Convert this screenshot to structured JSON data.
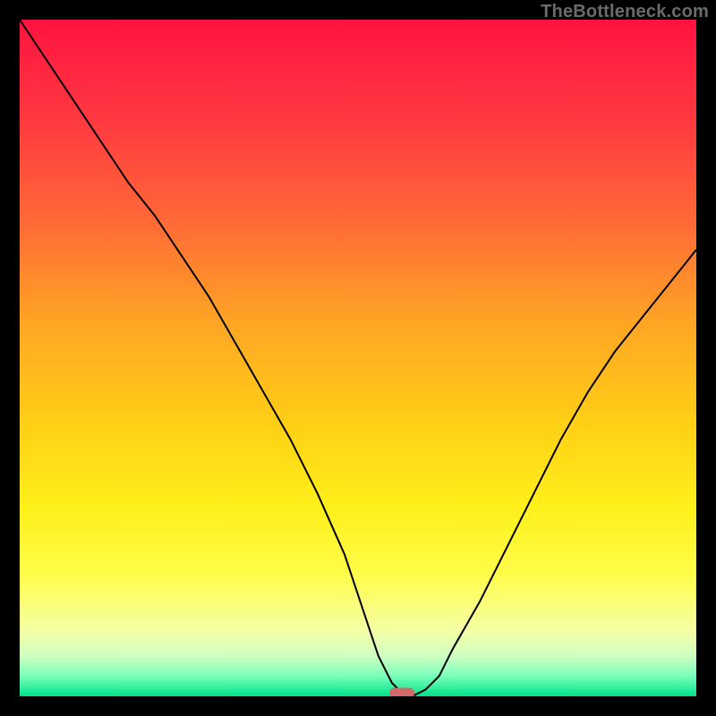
{
  "watermark": "TheBottleneck.com",
  "chart_data": {
    "type": "line",
    "title": "",
    "xlabel": "",
    "ylabel": "",
    "xlim": [
      0,
      100
    ],
    "ylim": [
      0,
      100
    ],
    "gradient_stops": [
      {
        "offset": 0.0,
        "color": "#ff1340"
      },
      {
        "offset": 0.15,
        "color": "#ff3940"
      },
      {
        "offset": 0.3,
        "color": "#ff6a36"
      },
      {
        "offset": 0.45,
        "color": "#ffa624"
      },
      {
        "offset": 0.6,
        "color": "#ffd015"
      },
      {
        "offset": 0.72,
        "color": "#fff01a"
      },
      {
        "offset": 0.82,
        "color": "#fffd4a"
      },
      {
        "offset": 0.9,
        "color": "#f6ffa2"
      },
      {
        "offset": 0.94,
        "color": "#d0ffc1"
      },
      {
        "offset": 0.97,
        "color": "#7affba"
      },
      {
        "offset": 1.0,
        "color": "#00e389"
      }
    ],
    "series": [
      {
        "name": "bottleneck-curve",
        "stroke": "#000000",
        "stroke_width": 2,
        "x": [
          0,
          4,
          8,
          12,
          16,
          20,
          24,
          28,
          32,
          36,
          40,
          44,
          48,
          51,
          53,
          55,
          57,
          58,
          60,
          62,
          64,
          68,
          72,
          76,
          80,
          84,
          88,
          92,
          96,
          100
        ],
        "values": [
          100,
          94,
          88,
          82,
          76,
          71,
          65,
          59,
          52,
          45,
          38,
          30,
          21,
          12,
          6,
          2,
          0,
          0,
          1,
          3,
          7,
          14,
          22,
          30,
          38,
          45,
          51,
          56,
          61,
          66
        ]
      }
    ],
    "marker": {
      "name": "optimum-marker",
      "x": 56.5,
      "y": 0.5,
      "color": "#d26a6a",
      "width": 3.7,
      "height": 1.5
    }
  }
}
